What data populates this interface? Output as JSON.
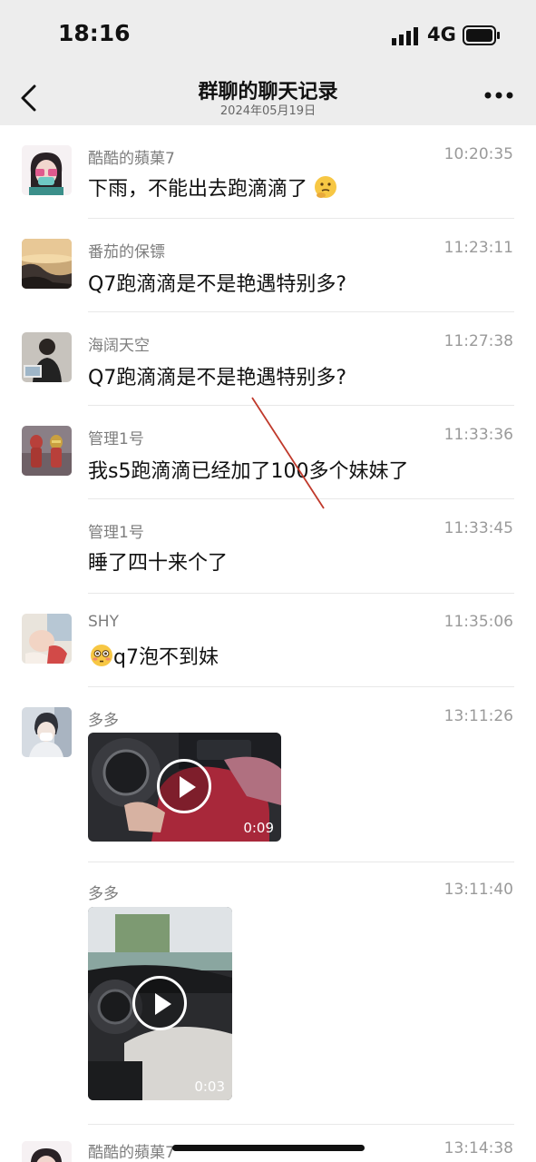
{
  "status": {
    "time": "18:16",
    "network": "4G"
  },
  "header": {
    "title": "群聊的聊天记录",
    "subtitle": "2024年05月19日"
  },
  "messages": [
    {
      "sender": "酷酷的蘋菓7",
      "time": "10:20:35",
      "text": "下雨，不能出去跑滴滴了",
      "emoji": "thinking-face"
    },
    {
      "sender": "番茄的保镖",
      "time": "11:23:11",
      "text": "Q7跑滴滴是不是艳遇特别多?"
    },
    {
      "sender": "海阔天空",
      "time": "11:27:38",
      "text": "Q7跑滴滴是不是艳遇特别多?"
    },
    {
      "sender": "管理1号",
      "time": "11:33:36",
      "text": "我s5跑滴滴已经加了100多个妹妹了"
    },
    {
      "sender": "管理1号",
      "time": "11:33:45",
      "text": "睡了四十来个了"
    },
    {
      "sender": "SHY",
      "time": "11:35:06",
      "text": "q7泡不到妹",
      "emoji": "flushed-face"
    },
    {
      "sender": "多多",
      "time": "13:11:26",
      "video_duration": "0:09"
    },
    {
      "sender": "多多",
      "time": "13:11:40",
      "video_duration": "0:03"
    },
    {
      "sender": "酷酷的蘋菓7",
      "time": "13:14:38"
    }
  ],
  "colors": {
    "nav_bg": "#ededed",
    "annotation_line": "#c0392b"
  }
}
